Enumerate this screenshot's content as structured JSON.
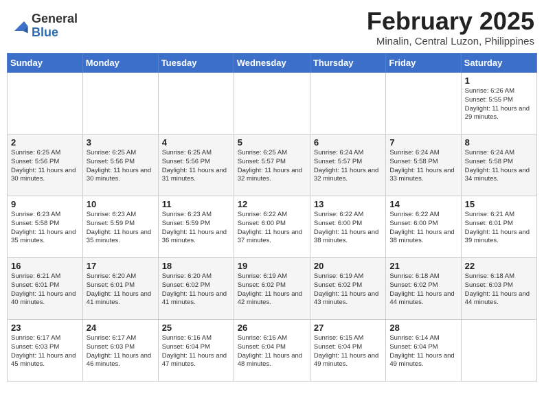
{
  "header": {
    "logo_general": "General",
    "logo_blue": "Blue",
    "month_title": "February 2025",
    "subtitle": "Minalin, Central Luzon, Philippines"
  },
  "weekdays": [
    "Sunday",
    "Monday",
    "Tuesday",
    "Wednesday",
    "Thursday",
    "Friday",
    "Saturday"
  ],
  "weeks": [
    [
      {
        "day": "",
        "info": ""
      },
      {
        "day": "",
        "info": ""
      },
      {
        "day": "",
        "info": ""
      },
      {
        "day": "",
        "info": ""
      },
      {
        "day": "",
        "info": ""
      },
      {
        "day": "",
        "info": ""
      },
      {
        "day": "1",
        "info": "Sunrise: 6:26 AM\nSunset: 5:55 PM\nDaylight: 11 hours and 29 minutes."
      }
    ],
    [
      {
        "day": "2",
        "info": "Sunrise: 6:25 AM\nSunset: 5:56 PM\nDaylight: 11 hours and 30 minutes."
      },
      {
        "day": "3",
        "info": "Sunrise: 6:25 AM\nSunset: 5:56 PM\nDaylight: 11 hours and 30 minutes."
      },
      {
        "day": "4",
        "info": "Sunrise: 6:25 AM\nSunset: 5:56 PM\nDaylight: 11 hours and 31 minutes."
      },
      {
        "day": "5",
        "info": "Sunrise: 6:25 AM\nSunset: 5:57 PM\nDaylight: 11 hours and 32 minutes."
      },
      {
        "day": "6",
        "info": "Sunrise: 6:24 AM\nSunset: 5:57 PM\nDaylight: 11 hours and 32 minutes."
      },
      {
        "day": "7",
        "info": "Sunrise: 6:24 AM\nSunset: 5:58 PM\nDaylight: 11 hours and 33 minutes."
      },
      {
        "day": "8",
        "info": "Sunrise: 6:24 AM\nSunset: 5:58 PM\nDaylight: 11 hours and 34 minutes."
      }
    ],
    [
      {
        "day": "9",
        "info": "Sunrise: 6:23 AM\nSunset: 5:58 PM\nDaylight: 11 hours and 35 minutes."
      },
      {
        "day": "10",
        "info": "Sunrise: 6:23 AM\nSunset: 5:59 PM\nDaylight: 11 hours and 35 minutes."
      },
      {
        "day": "11",
        "info": "Sunrise: 6:23 AM\nSunset: 5:59 PM\nDaylight: 11 hours and 36 minutes."
      },
      {
        "day": "12",
        "info": "Sunrise: 6:22 AM\nSunset: 6:00 PM\nDaylight: 11 hours and 37 minutes."
      },
      {
        "day": "13",
        "info": "Sunrise: 6:22 AM\nSunset: 6:00 PM\nDaylight: 11 hours and 38 minutes."
      },
      {
        "day": "14",
        "info": "Sunrise: 6:22 AM\nSunset: 6:00 PM\nDaylight: 11 hours and 38 minutes."
      },
      {
        "day": "15",
        "info": "Sunrise: 6:21 AM\nSunset: 6:01 PM\nDaylight: 11 hours and 39 minutes."
      }
    ],
    [
      {
        "day": "16",
        "info": "Sunrise: 6:21 AM\nSunset: 6:01 PM\nDaylight: 11 hours and 40 minutes."
      },
      {
        "day": "17",
        "info": "Sunrise: 6:20 AM\nSunset: 6:01 PM\nDaylight: 11 hours and 41 minutes."
      },
      {
        "day": "18",
        "info": "Sunrise: 6:20 AM\nSunset: 6:02 PM\nDaylight: 11 hours and 41 minutes."
      },
      {
        "day": "19",
        "info": "Sunrise: 6:19 AM\nSunset: 6:02 PM\nDaylight: 11 hours and 42 minutes."
      },
      {
        "day": "20",
        "info": "Sunrise: 6:19 AM\nSunset: 6:02 PM\nDaylight: 11 hours and 43 minutes."
      },
      {
        "day": "21",
        "info": "Sunrise: 6:18 AM\nSunset: 6:02 PM\nDaylight: 11 hours and 44 minutes."
      },
      {
        "day": "22",
        "info": "Sunrise: 6:18 AM\nSunset: 6:03 PM\nDaylight: 11 hours and 44 minutes."
      }
    ],
    [
      {
        "day": "23",
        "info": "Sunrise: 6:17 AM\nSunset: 6:03 PM\nDaylight: 11 hours and 45 minutes."
      },
      {
        "day": "24",
        "info": "Sunrise: 6:17 AM\nSunset: 6:03 PM\nDaylight: 11 hours and 46 minutes."
      },
      {
        "day": "25",
        "info": "Sunrise: 6:16 AM\nSunset: 6:04 PM\nDaylight: 11 hours and 47 minutes."
      },
      {
        "day": "26",
        "info": "Sunrise: 6:16 AM\nSunset: 6:04 PM\nDaylight: 11 hours and 48 minutes."
      },
      {
        "day": "27",
        "info": "Sunrise: 6:15 AM\nSunset: 6:04 PM\nDaylight: 11 hours and 49 minutes."
      },
      {
        "day": "28",
        "info": "Sunrise: 6:14 AM\nSunset: 6:04 PM\nDaylight: 11 hours and 49 minutes."
      },
      {
        "day": "",
        "info": ""
      }
    ]
  ]
}
